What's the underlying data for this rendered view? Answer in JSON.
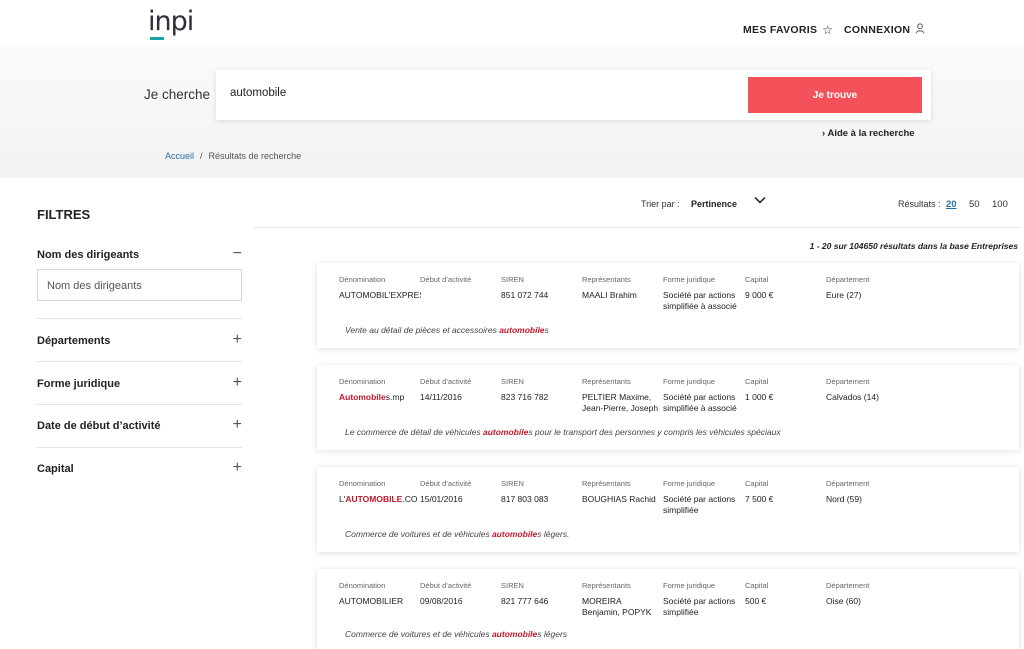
{
  "header": {
    "logo": "inpi",
    "favoris_label": "MES FAVORIS",
    "connexion_label": "CONNEXION"
  },
  "search": {
    "label": "Je cherche",
    "value": "automobile",
    "button_label": "Je trouve",
    "help_label": "Aide à la recherche"
  },
  "breadcrumb": {
    "home": "Accueil",
    "separator": "/",
    "current": "Résultats de recherche"
  },
  "filters": {
    "title": "FILTRES",
    "items": [
      {
        "label": "Nom des dirigeants",
        "expanded": true,
        "placeholder": "Nom des dirigeants"
      },
      {
        "label": "Départements",
        "expanded": false
      },
      {
        "label": "Forme juridique",
        "expanded": false
      },
      {
        "label": "Date de début d’activité",
        "expanded": false
      },
      {
        "label": "Capital",
        "expanded": false
      }
    ]
  },
  "sort": {
    "label": "Trier par :",
    "value": "Pertinence",
    "results_label": "Résultats :",
    "options": [
      "20",
      "50",
      "100"
    ],
    "selected": "20"
  },
  "summary": "1 - 20 sur 104650 résultats dans la base Entreprises",
  "columns": [
    "Dénomination",
    "Début d’activité",
    "SIREN",
    "Représentants",
    "Forme juridique",
    "Capital",
    "Département"
  ],
  "results": [
    {
      "name_before": "AUTOMOBIL'EXPRES",
      "name_highlight": "",
      "name_after": "",
      "start": "",
      "siren": "851 072 744",
      "rep": [
        "MAALI Brahim"
      ],
      "forme": [
        "Société par actions",
        "simplifiée à associé"
      ],
      "capital": "9 000 €",
      "dept": "Eure (27)",
      "desc_before": "Vente au détail de pièces et accessoires ",
      "desc_highlight": "automobile",
      "desc_after": "s"
    },
    {
      "name_before": "",
      "name_highlight": "Automobile",
      "name_after": "s.mp",
      "start": "14/11/2016",
      "siren": "823 716 782",
      "rep": [
        "PELTIER Maxime,",
        "Jean-Pierre, Joseph"
      ],
      "forme": [
        "Société par actions",
        "simplifiée à associé"
      ],
      "capital": "1 000 €",
      "dept": "Calvados (14)",
      "desc_before": "Le commerce de détail de véhicules ",
      "desc_highlight": "automobile",
      "desc_after": "s pour le transport des personnes y compris les véhicules spéciaux"
    },
    {
      "name_before": "L'",
      "name_highlight": "AUTOMOBILE",
      "name_after": ".CO",
      "start": "15/01/2016",
      "siren": "817 803 083",
      "rep": [
        "BOUGHIAS Rachid"
      ],
      "forme": [
        "Société par actions",
        "simplifiée"
      ],
      "capital": "7 500 €",
      "dept": "Nord (59)",
      "desc_before": "Commerce de voitures et de véhicules ",
      "desc_highlight": "automobile",
      "desc_after": "s légers."
    },
    {
      "name_before": "AUTOMOBILIER",
      "name_highlight": "",
      "name_after": "",
      "start": "09/08/2016",
      "siren": "821 777 646",
      "rep": [
        "MOREIRA",
        "Benjamin, POPYK"
      ],
      "forme": [
        "Société par actions",
        "simplifiée"
      ],
      "capital": "500 €",
      "dept": "Oise (60)",
      "desc_before": "Commerce de voitures et de véhicules ",
      "desc_highlight": "automobile",
      "desc_after": "s légers"
    }
  ]
}
